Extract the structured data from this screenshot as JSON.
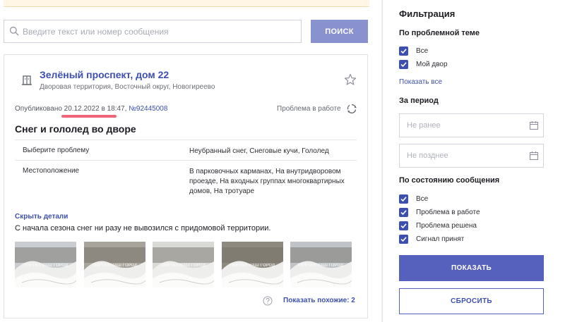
{
  "search": {
    "placeholder": "Введите текст или номер сообщения",
    "button_label": "ПОИСК"
  },
  "card": {
    "title": "Зелёный проспект, дом 22",
    "subtitle": "Дворовая территория, Восточный округ, Новогиреево",
    "published_prefix": "Опубликовано 20.12.2022 в 18:47, ",
    "message_id": "№92445008",
    "status": "Проблема в работе",
    "issue_title": "Снег и гололед во дворе",
    "details": [
      {
        "key": "Выберите проблему",
        "value": "Неубранный снег, Снеговые кучи, Гололед"
      },
      {
        "key": "Местоположение",
        "value": "В парковочных карманах, На внутридворовом проезде, На входных группах многоквартирных домов, На тротуаре"
      }
    ],
    "hide_details": "Скрыть детали",
    "description": "С начала сезона снег ни разу не вывозился с придомовой территории.",
    "photo_watermark": "ПОРТАЛ НАШ ГОРОД",
    "photo_count": 5,
    "similar_link": "Показать похожие: 2"
  },
  "filters": {
    "title": "Фильтрация",
    "topic": {
      "heading": "По проблемной теме",
      "options": [
        {
          "label": "Все",
          "checked": true
        },
        {
          "label": "Мой двор",
          "checked": true
        }
      ],
      "show_all": "Показать все"
    },
    "period": {
      "heading": "За период",
      "from_placeholder": "Не ранее",
      "to_placeholder": "Не позднее"
    },
    "state": {
      "heading": "По состоянию сообщения",
      "options": [
        {
          "label": "Все",
          "checked": true
        },
        {
          "label": "Проблема в работе",
          "checked": true
        },
        {
          "label": "Проблема решена",
          "checked": true
        },
        {
          "label": "Сигнал принят",
          "checked": true
        }
      ]
    },
    "apply_label": "ПОКАЗАТЬ",
    "reset_label": "СБРОСИТЬ"
  },
  "colors": {
    "accent": "#3d50b0",
    "button": "#5561bd",
    "search_button": "#8a91cf",
    "highlight": "#f0657a"
  }
}
